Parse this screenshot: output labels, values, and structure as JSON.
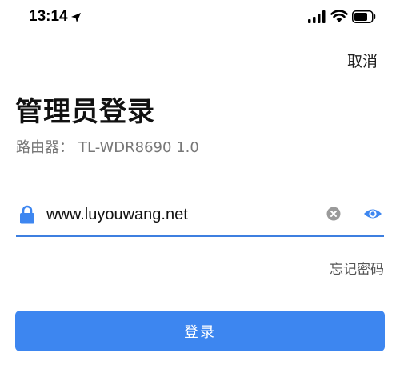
{
  "status_bar": {
    "time": "13:14",
    "icons": [
      "location-arrow-icon",
      "signal-icon",
      "wifi-icon",
      "battery-icon"
    ]
  },
  "header": {
    "cancel_label": "取消"
  },
  "main": {
    "title": "管理员登录",
    "device_label": "路由器：",
    "device_model": "TL-WDR8690 1.0",
    "password": {
      "value": "www.luyouwang.net",
      "icon": "lock-icon",
      "clear_icon": "clear-icon",
      "toggle_icon": "eye-icon"
    },
    "forgot_label": "忘记密码",
    "login_label": "登录"
  },
  "colors": {
    "accent": "#3d86f0",
    "underline": "#3d7fe0",
    "subtitle_text": "#777777"
  }
}
